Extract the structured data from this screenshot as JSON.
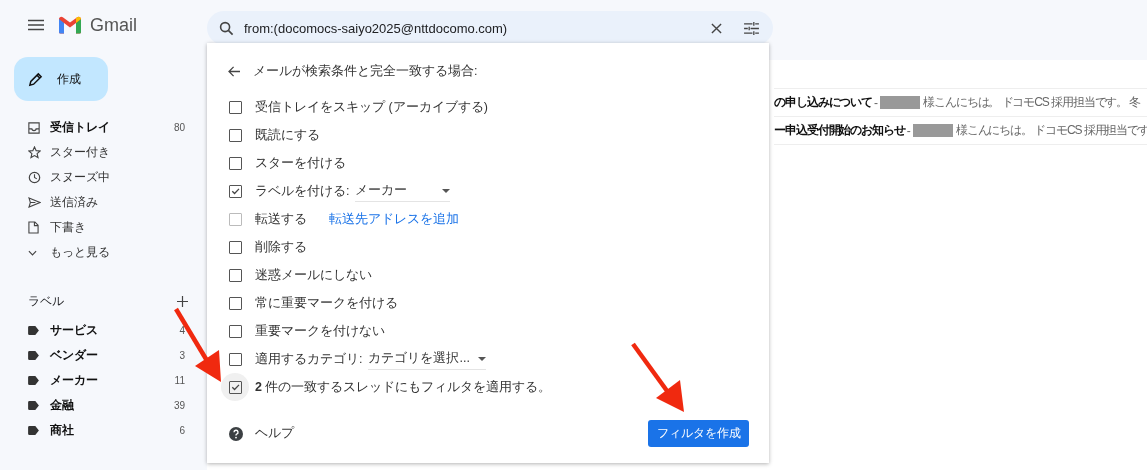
{
  "app": {
    "name": "Gmail"
  },
  "search": {
    "value": "from:(docomocs-saiyo2025@nttdocomo.com)"
  },
  "compose": {
    "label": "作成"
  },
  "nav": [
    {
      "kind": "inbox",
      "label": "受信トレイ",
      "count": "80",
      "unread": true
    },
    {
      "kind": "star",
      "label": "スター付き",
      "unread": false
    },
    {
      "kind": "snoozed",
      "label": "スヌーズ中",
      "unread": false
    },
    {
      "kind": "sent",
      "label": "送信済み",
      "unread": false
    },
    {
      "kind": "draft",
      "label": "下書き",
      "unread": false
    },
    {
      "kind": "more",
      "label": "もっと見る",
      "unread": false
    }
  ],
  "labels": {
    "title": "ラベル",
    "items": [
      {
        "label": "サービス",
        "count": "4",
        "unread": true
      },
      {
        "label": "ベンダー",
        "count": "3",
        "unread": true
      },
      {
        "label": "メーカー",
        "count": "11",
        "unread": true
      },
      {
        "label": "金融",
        "count": "39",
        "unread": true
      },
      {
        "label": "商社",
        "count": "6",
        "unread": true
      }
    ]
  },
  "mails": [
    {
      "subject": "の申し込みについて",
      "separator": "-",
      "snippet": "様こんにちは。 ドコモCS 採用担当です。 冬"
    },
    {
      "subject": "ー申込受付開始のお知らせ",
      "separator": "-",
      "snippet": "様こんにちは。 ドコモCS 採用担当です"
    }
  ],
  "filter": {
    "heading": "メールが検索条件と完全一致する場合:",
    "options": [
      {
        "kind": "checkbox",
        "label": "受信トレイをスキップ (アーカイブする)",
        "checked": false,
        "disabled": false,
        "focused": false
      },
      {
        "kind": "checkbox",
        "label": "既読にする",
        "checked": false,
        "disabled": false,
        "focused": false
      },
      {
        "kind": "checkbox",
        "label": "スターを付ける",
        "checked": false,
        "disabled": false,
        "focused": false
      },
      {
        "kind": "select",
        "label": "ラベルを付ける:",
        "value": "メーカー",
        "checked": true,
        "disabled": false,
        "focused": false
      },
      {
        "kind": "link",
        "label": "転送する",
        "link": "転送先アドレスを追加",
        "checked": false,
        "disabled": true,
        "focused": false
      },
      {
        "kind": "checkbox",
        "label": "削除する",
        "checked": false,
        "disabled": false,
        "focused": false
      },
      {
        "kind": "checkbox",
        "label": "迷惑メールにしない",
        "checked": false,
        "disabled": false,
        "focused": false
      },
      {
        "kind": "checkbox",
        "label": "常に重要マークを付ける",
        "checked": false,
        "disabled": false,
        "focused": false
      },
      {
        "kind": "checkbox",
        "label": "重要マークを付けない",
        "checked": false,
        "disabled": false,
        "focused": false
      },
      {
        "kind": "select",
        "label": "適用するカテゴリ:",
        "value": "カテゴリを選択...",
        "checked": false,
        "disabled": false,
        "focused": false
      },
      {
        "kind": "checkbox",
        "label": "**2** 件の一致するスレッドにもフィルタを適用する。",
        "checked": true,
        "disabled": false,
        "focused": true
      }
    ],
    "help": "ヘルプ",
    "submit": "フィルタを作成"
  }
}
